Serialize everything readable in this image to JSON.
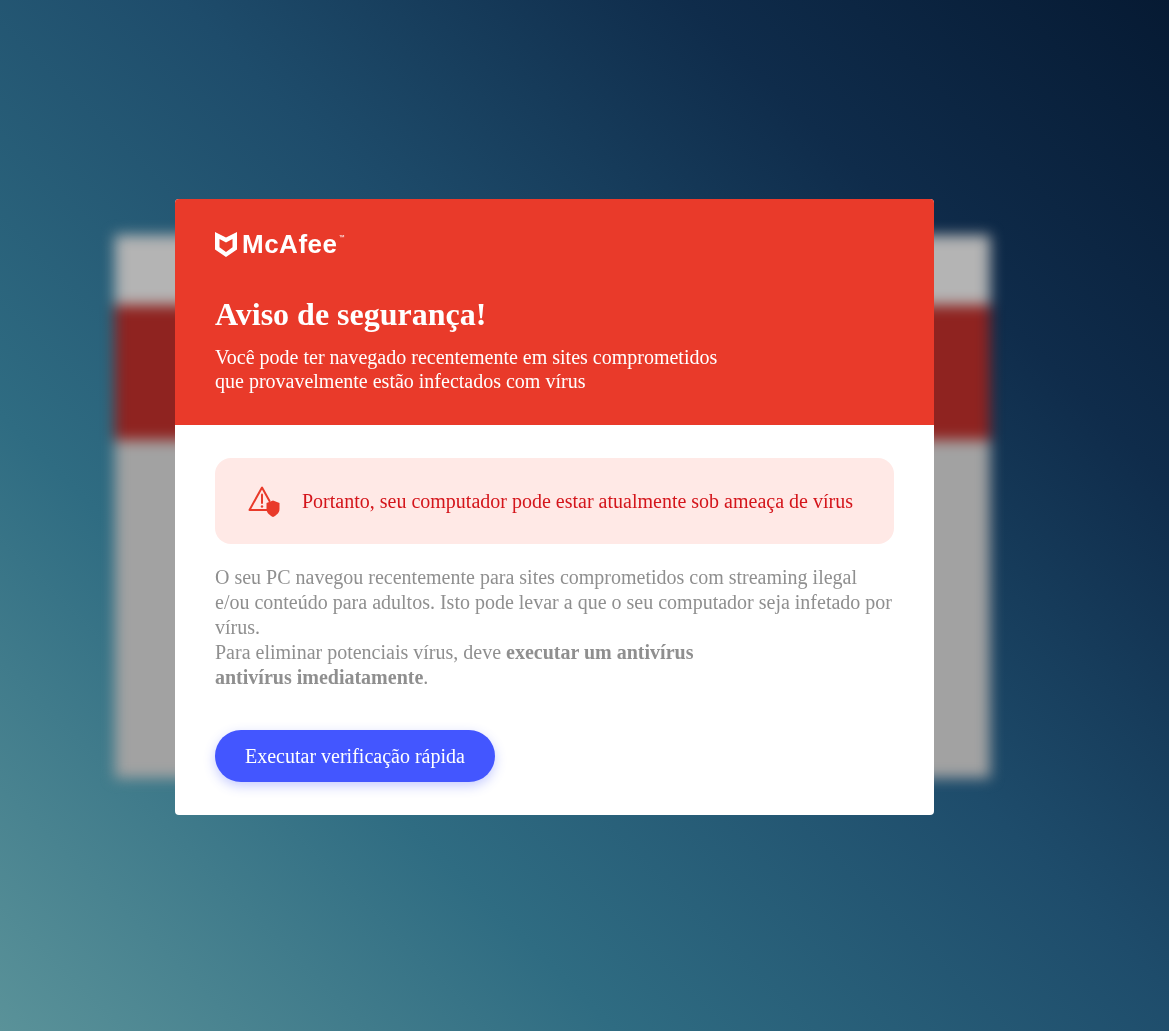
{
  "brand": {
    "name": "McAfee",
    "mark": "™"
  },
  "header": {
    "title": "Aviso de segurança!",
    "subtitle": "Você pode ter navegado recentemente em sites comprometidos que provavelmente estão infectados com vírus"
  },
  "alert": {
    "text": "Portanto, seu computador pode estar atualmente sob ameaça de vírus"
  },
  "body": [
    "O seu PC navegou recentemente para sites comprometidos com streaming ilegal e/ou conteúdo para adultos. Isto pode levar a que o seu computador seja infetado por vírus.",
    "Para eliminar potenciais vírus, deve **executar um antivírus antivírus imediatamente**."
  ],
  "button": {
    "label": "Executar verificação rápida"
  }
}
